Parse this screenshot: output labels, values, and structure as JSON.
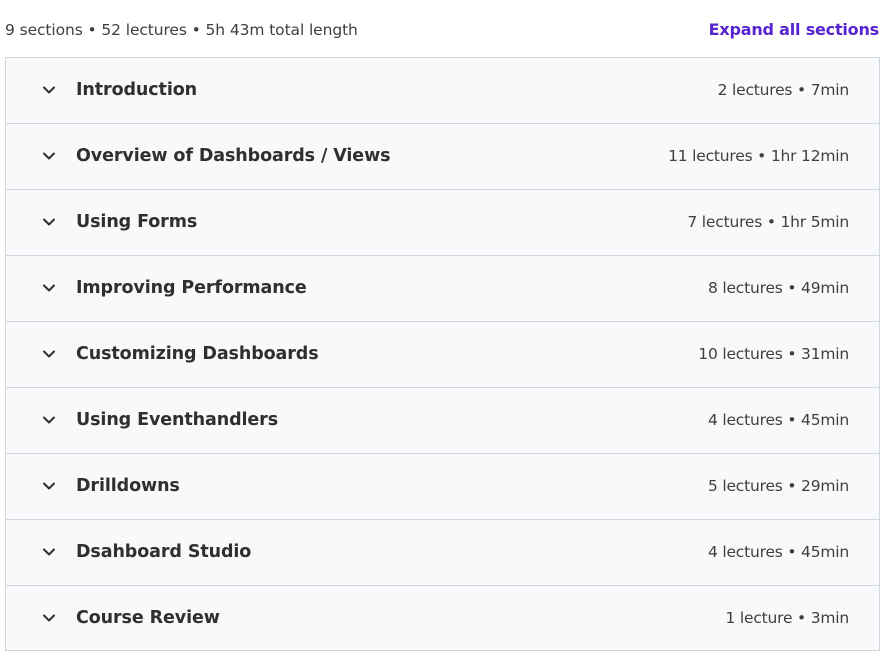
{
  "summary": {
    "text": "9 sections • 52 lectures • 5h 43m total length",
    "expand_label": "Expand all sections"
  },
  "colors": {
    "accent": "#5624d0",
    "row_bg": "#f7f9fa",
    "border": "#d1d7dc",
    "text": "#2d2f31"
  },
  "icons": {
    "section_toggle": "chevron-down-icon"
  },
  "sections": [
    {
      "title": "Introduction",
      "meta": "2 lectures • 7min"
    },
    {
      "title": "Overview of Dashboards / Views",
      "meta": "11 lectures • 1hr 12min"
    },
    {
      "title": "Using Forms",
      "meta": "7 lectures • 1hr 5min"
    },
    {
      "title": "Improving Performance",
      "meta": "8 lectures • 49min"
    },
    {
      "title": "Customizing Dashboards",
      "meta": "10 lectures • 31min"
    },
    {
      "title": "Using Eventhandlers",
      "meta": "4 lectures • 45min"
    },
    {
      "title": "Drilldowns",
      "meta": "5 lectures • 29min"
    },
    {
      "title": "Dsahboard Studio",
      "meta": "4 lectures • 45min"
    },
    {
      "title": "Course Review",
      "meta": "1 lecture • 3min"
    }
  ]
}
